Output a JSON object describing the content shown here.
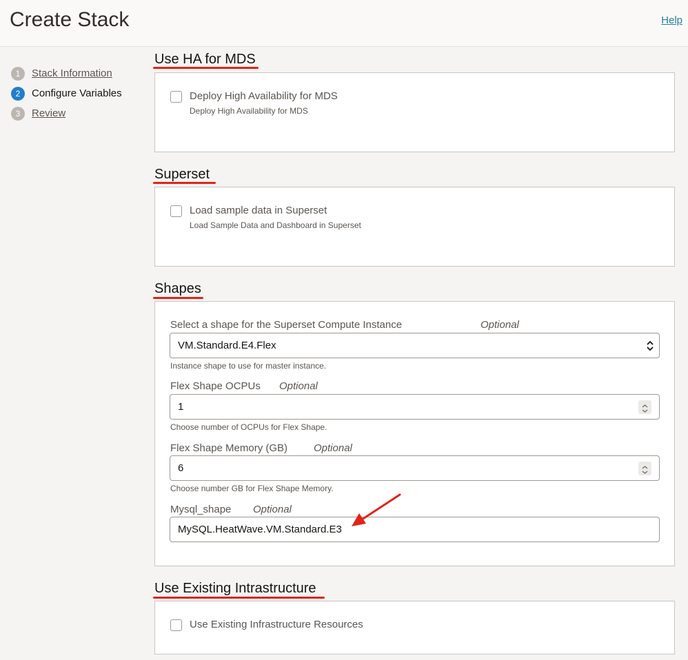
{
  "header": {
    "title": "Create Stack",
    "help": "Help"
  },
  "steps": [
    {
      "num": "1",
      "label": "Stack Information"
    },
    {
      "num": "2",
      "label": "Configure Variables"
    },
    {
      "num": "3",
      "label": "Review"
    }
  ],
  "sections": {
    "ha": {
      "title": "Use HA for MDS",
      "checkbox_label": "Deploy High Availability for MDS",
      "checkbox_help": "Deploy High Availability for MDS"
    },
    "superset": {
      "title": "Superset",
      "checkbox_label": "Load sample data in Superset",
      "checkbox_help": "Load Sample Data and Dashboard in Superset"
    },
    "shapes": {
      "title": "Shapes",
      "optional": "Optional",
      "compute_shape": {
        "label": "Select a shape for the Superset Compute Instance",
        "value": "VM.Standard.E4.Flex",
        "help": "Instance shape to use for master instance."
      },
      "ocpus": {
        "label": "Flex Shape OCPUs",
        "value": "1",
        "help": "Choose number of OCPUs for Flex Shape."
      },
      "memory": {
        "label": "Flex Shape Memory (GB)",
        "value": "6",
        "help": "Choose number GB for Flex Shape Memory."
      },
      "mysql_shape": {
        "label": "Mysql_shape",
        "value": "MySQL.HeatWave.VM.Standard.E3"
      }
    },
    "existing": {
      "title": "Use Existing Intrastructure",
      "checkbox_label": "Use Existing Infrastructure Resources"
    }
  },
  "colors": {
    "accent": "#227ecc",
    "annotation": "#e2231a",
    "link": "#227e9e"
  }
}
